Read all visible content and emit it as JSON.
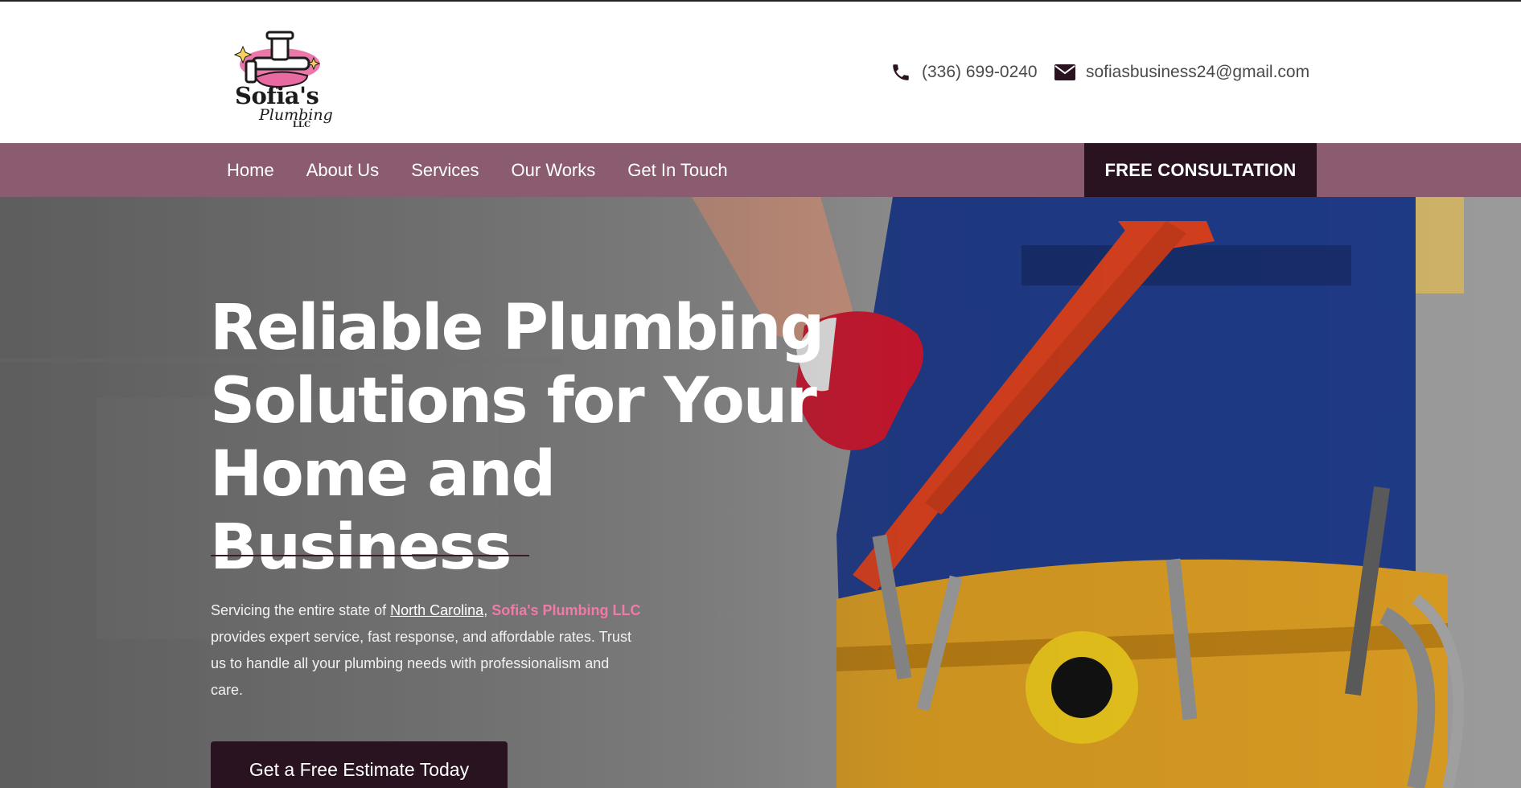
{
  "brand": {
    "name": "Sofia's",
    "script": "Plumbing",
    "suffix": "LLC",
    "colors": {
      "accent": "#8b5c70",
      "dark": "#2a1320",
      "pink": "#f07aa8"
    }
  },
  "contact": {
    "phone": "(336) 699-0240",
    "phone_icon": "phone-icon",
    "email": "sofiasbusiness24@gmail.com",
    "email_icon": "envelope-icon"
  },
  "nav": {
    "items": [
      {
        "label": "Home"
      },
      {
        "label": "About Us"
      },
      {
        "label": "Services"
      },
      {
        "label": "Our Works"
      },
      {
        "label": "Get In Touch"
      }
    ],
    "cta": "FREE CONSULTATION"
  },
  "hero": {
    "title": "Reliable Plumbing Solutions for Your Home and Business",
    "desc_prefix": "Servicing the entire state of ",
    "desc_location": "North Carolina",
    "desc_comma": ", ",
    "desc_brand": "Sofia's Plumbing LLC",
    "desc_rest": " provides expert service, fast response, and affordable rates. Trust us to handle all your plumbing needs with professionalism and care.",
    "button": "Get a Free Estimate Today"
  }
}
